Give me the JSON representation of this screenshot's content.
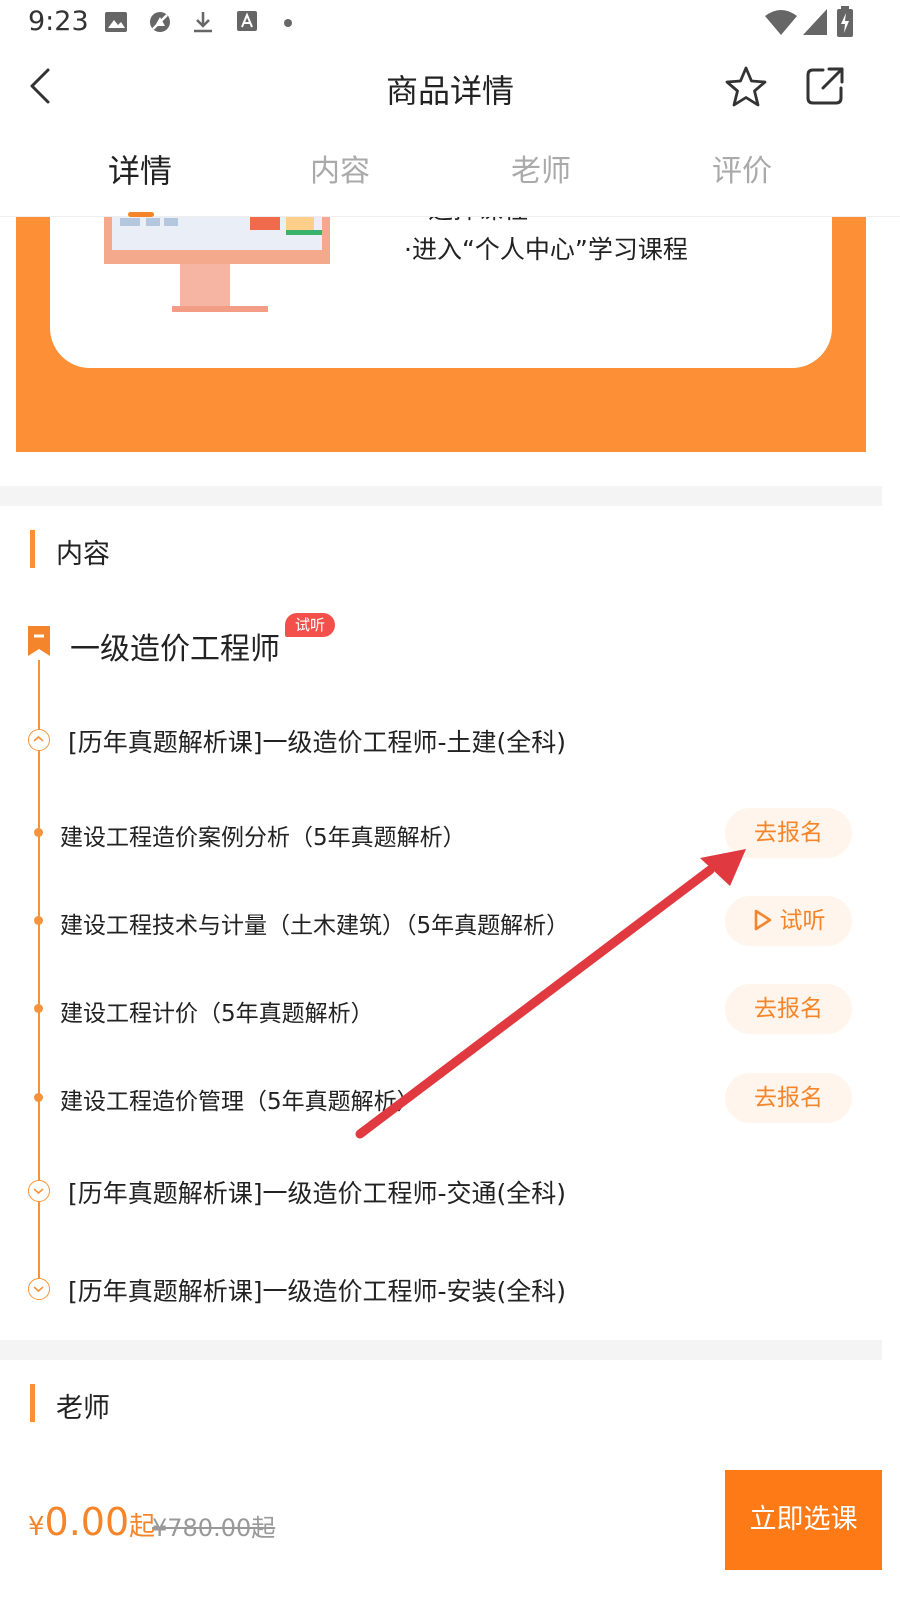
{
  "status_bar": {
    "time": "9:23",
    "icons": [
      "image-icon",
      "no-signal-icon",
      "download-icon",
      "text-a-icon",
      "dot-icon",
      "wifi-icon",
      "cellular-icon",
      "battery-charging-icon"
    ]
  },
  "header": {
    "title": "商品详情",
    "back_icon": "chevron-left-icon",
    "favorite_icon": "star-icon",
    "share_icon": "share-icon"
  },
  "tabs": [
    {
      "label": "详情",
      "active": true
    },
    {
      "label": "内容",
      "active": false
    },
    {
      "label": "老师",
      "active": false
    },
    {
      "label": "评价",
      "active": false
    }
  ],
  "banner": {
    "partial_text": "·选择课程",
    "text": "·进入“个人中心”学习课程"
  },
  "content_section": {
    "title": "内容",
    "course": {
      "title": "一级造价工程师",
      "badge": "试听",
      "groups": [
        {
          "title": "[历年真题解析课]一级造价工程师-土建(全科)",
          "expanded": true,
          "lessons": [
            {
              "title": "建设工程造价案例分析（5年真题解析）",
              "action": "去报名",
              "action_type": "enroll"
            },
            {
              "title": "建设工程技术与计量（土木建筑）（5年真题解析）",
              "action": "试听",
              "action_type": "trial"
            },
            {
              "title": "建设工程计价（5年真题解析）",
              "action": "去报名",
              "action_type": "enroll"
            },
            {
              "title": "建设工程造价管理（5年真题解析）",
              "action": "去报名",
              "action_type": "enroll"
            }
          ]
        },
        {
          "title": "[历年真题解析课]一级造价工程师-交通(全科)",
          "expanded": false
        },
        {
          "title": "[历年真题解析课]一级造价工程师-安装(全科)",
          "expanded": false
        }
      ]
    }
  },
  "teacher_section": {
    "title": "老师"
  },
  "bottom_bar": {
    "currency": "¥",
    "price": "0.00",
    "price_suffix": "起",
    "original_price": "¥780.00起",
    "cta": "立即选课"
  },
  "colors": {
    "accent": "#fd8f36",
    "cta": "#fd7a16",
    "badge": "#f3504b",
    "arrow": "#e0393f"
  }
}
